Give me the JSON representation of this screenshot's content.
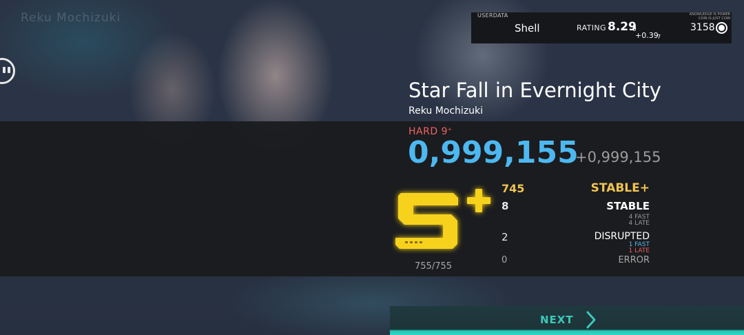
{
  "background": {
    "tag": "Reku Mochizuki"
  },
  "userdata": {
    "label": "USERDATA",
    "name": "Shell",
    "rating_label": "RATING",
    "rating": "8.29",
    "rating_small": "0",
    "rating_delta": "+0.39",
    "rating_delta_small": "7",
    "knowledge_line1": "KNOWLEDGE IS POWER",
    "knowledge_line2": "COIN IS JUST COIN",
    "coins": "3158",
    "coin_icon": "coin-icon"
  },
  "song": {
    "title": "Star Fall in Evernight City",
    "artist": "Reku Mochizuki",
    "difficulty": "HARD 9",
    "difficulty_plus": "+"
  },
  "result": {
    "score": "0,999,155",
    "score_delta": "+0,999,155",
    "grade": "S+",
    "notes_progress": "755/755"
  },
  "judgements": {
    "stable_plus": {
      "count": "745",
      "label": "STABLE+"
    },
    "stable": {
      "count": "8",
      "label": "STABLE",
      "fast": "4 FAST",
      "late": "4 LATE"
    },
    "disrupted": {
      "count": "2",
      "label": "DISRUPTED",
      "fast": "1 FAST",
      "late": "1 LATE"
    },
    "error": {
      "count": "0",
      "label": "ERROR"
    }
  },
  "colors": {
    "score": "#4db8f0",
    "grade": "#f7d21c",
    "stable_plus": "#f0c452",
    "difficulty": "#ef6464",
    "fast": "#5ab8e8",
    "late": "#e86060",
    "next": "#3cc8b8"
  },
  "navigation": {
    "next_label": "NEXT",
    "next_icon": "chevron-right-icon"
  },
  "controls": {
    "pause_icon": "pause-icon"
  }
}
